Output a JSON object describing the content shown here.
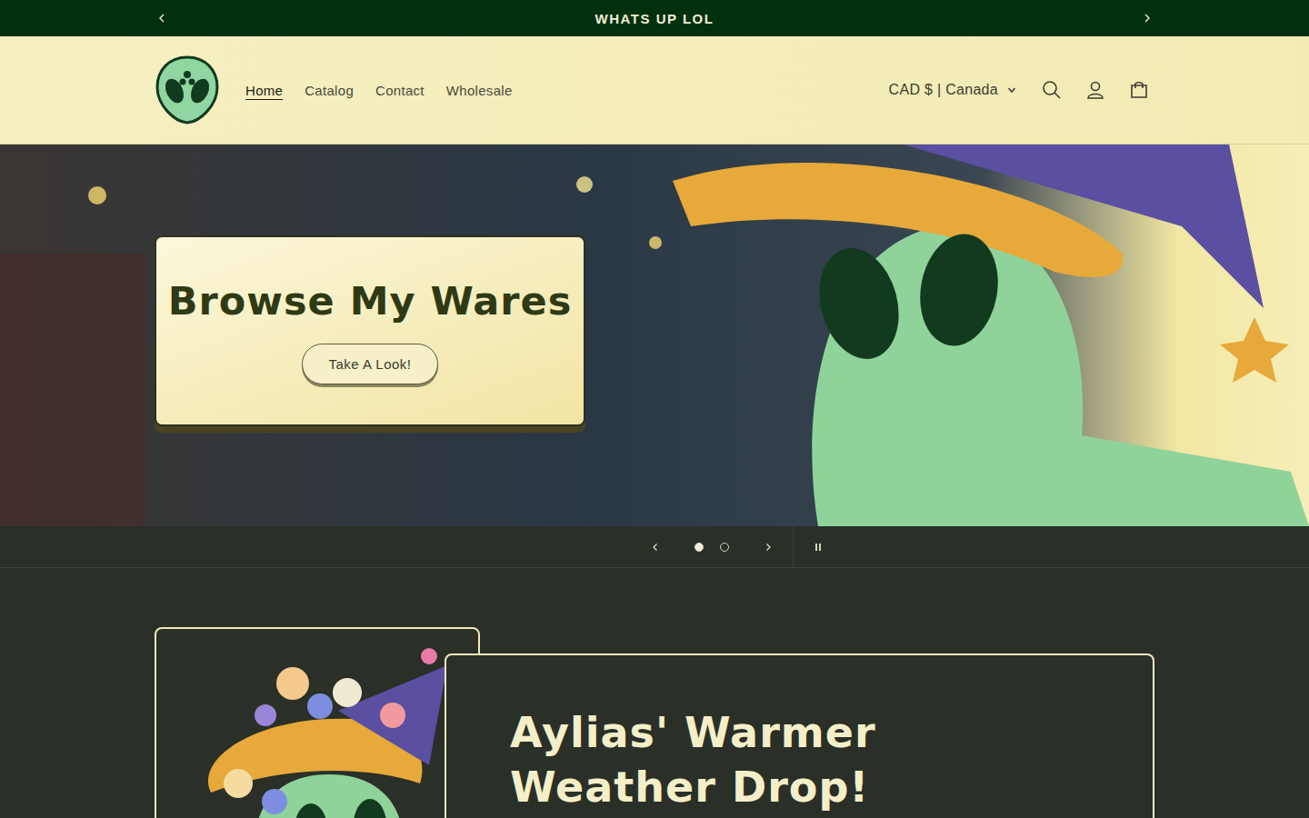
{
  "announcement": {
    "text": "WHATS UP LOL"
  },
  "header": {
    "nav": [
      {
        "label": "Home",
        "selected": true
      },
      {
        "label": "Catalog",
        "selected": false
      },
      {
        "label": "Contact",
        "selected": false
      },
      {
        "label": "Wholesale",
        "selected": false
      }
    ],
    "locale": "CAD $ | Canada"
  },
  "hero": {
    "heading": "Browse My Wares",
    "button": "Take A Look!"
  },
  "slideshow": {
    "slides": [
      {
        "selected": true
      },
      {
        "selected": false
      }
    ],
    "playing": true
  },
  "feature": {
    "heading": "Aylias' Warmer Weather Drop!"
  }
}
